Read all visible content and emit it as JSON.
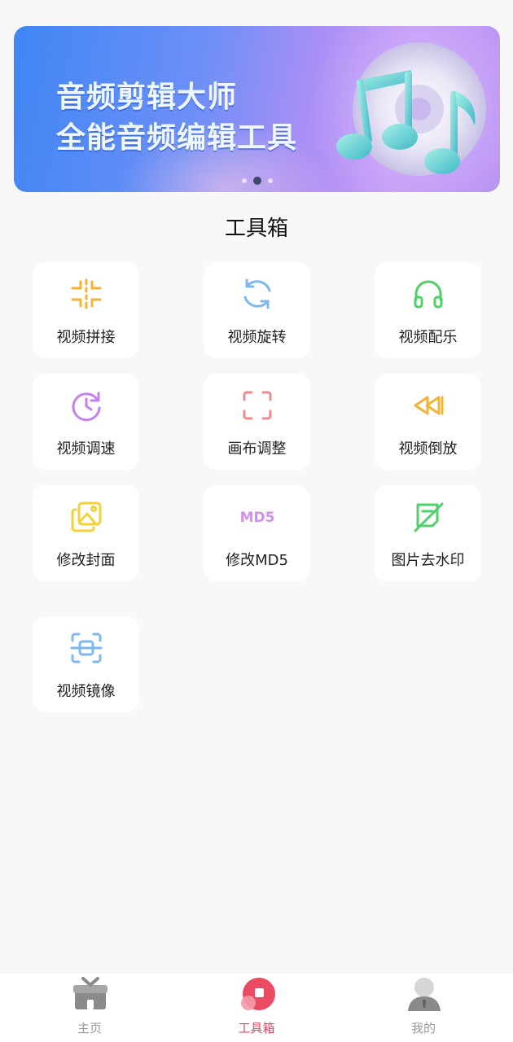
{
  "banner": {
    "title_line1": "音频剪辑大师",
    "title_line2": "全能音频编辑工具",
    "carousel_dots": 3,
    "active_dot": 2
  },
  "section_title": "工具箱",
  "tools": [
    {
      "label": "视频拼接",
      "icon": "merge-icon",
      "color": "#f5b335"
    },
    {
      "label": "视频旋转",
      "icon": "rotate-icon",
      "color": "#7fb8f0"
    },
    {
      "label": "视频配乐",
      "icon": "headphones-icon",
      "color": "#4fd16a"
    },
    {
      "label": "视频调速",
      "icon": "clock-speed-icon",
      "color": "#c77ef0"
    },
    {
      "label": "画布调整",
      "icon": "crop-frame-icon",
      "color": "#f08a8a"
    },
    {
      "label": "视频倒放",
      "icon": "rewind-icon",
      "color": "#f5b335"
    },
    {
      "label": "修改封面",
      "icon": "image-cover-icon",
      "color": "#f2d23a"
    },
    {
      "label": "修改MD5",
      "icon": "md5-icon",
      "color": "#d48ef2",
      "icon_text": "MD5"
    },
    {
      "label": "图片去水印",
      "icon": "remove-watermark-icon",
      "color": "#4fd16a"
    },
    {
      "label": "视频镜像",
      "icon": "mirror-scan-icon",
      "color": "#7fb8f0"
    }
  ],
  "bottom_nav": [
    {
      "label": "主页",
      "icon": "home-gift-icon",
      "active": false
    },
    {
      "label": "工具箱",
      "icon": "toolbox-icon",
      "active": true
    },
    {
      "label": "我的",
      "icon": "profile-icon",
      "active": false
    }
  ],
  "colors": {
    "accent": "#e8445f",
    "background": "#f8f8f8",
    "banner_start": "#3f86f4",
    "banner_end": "#b793f3"
  }
}
